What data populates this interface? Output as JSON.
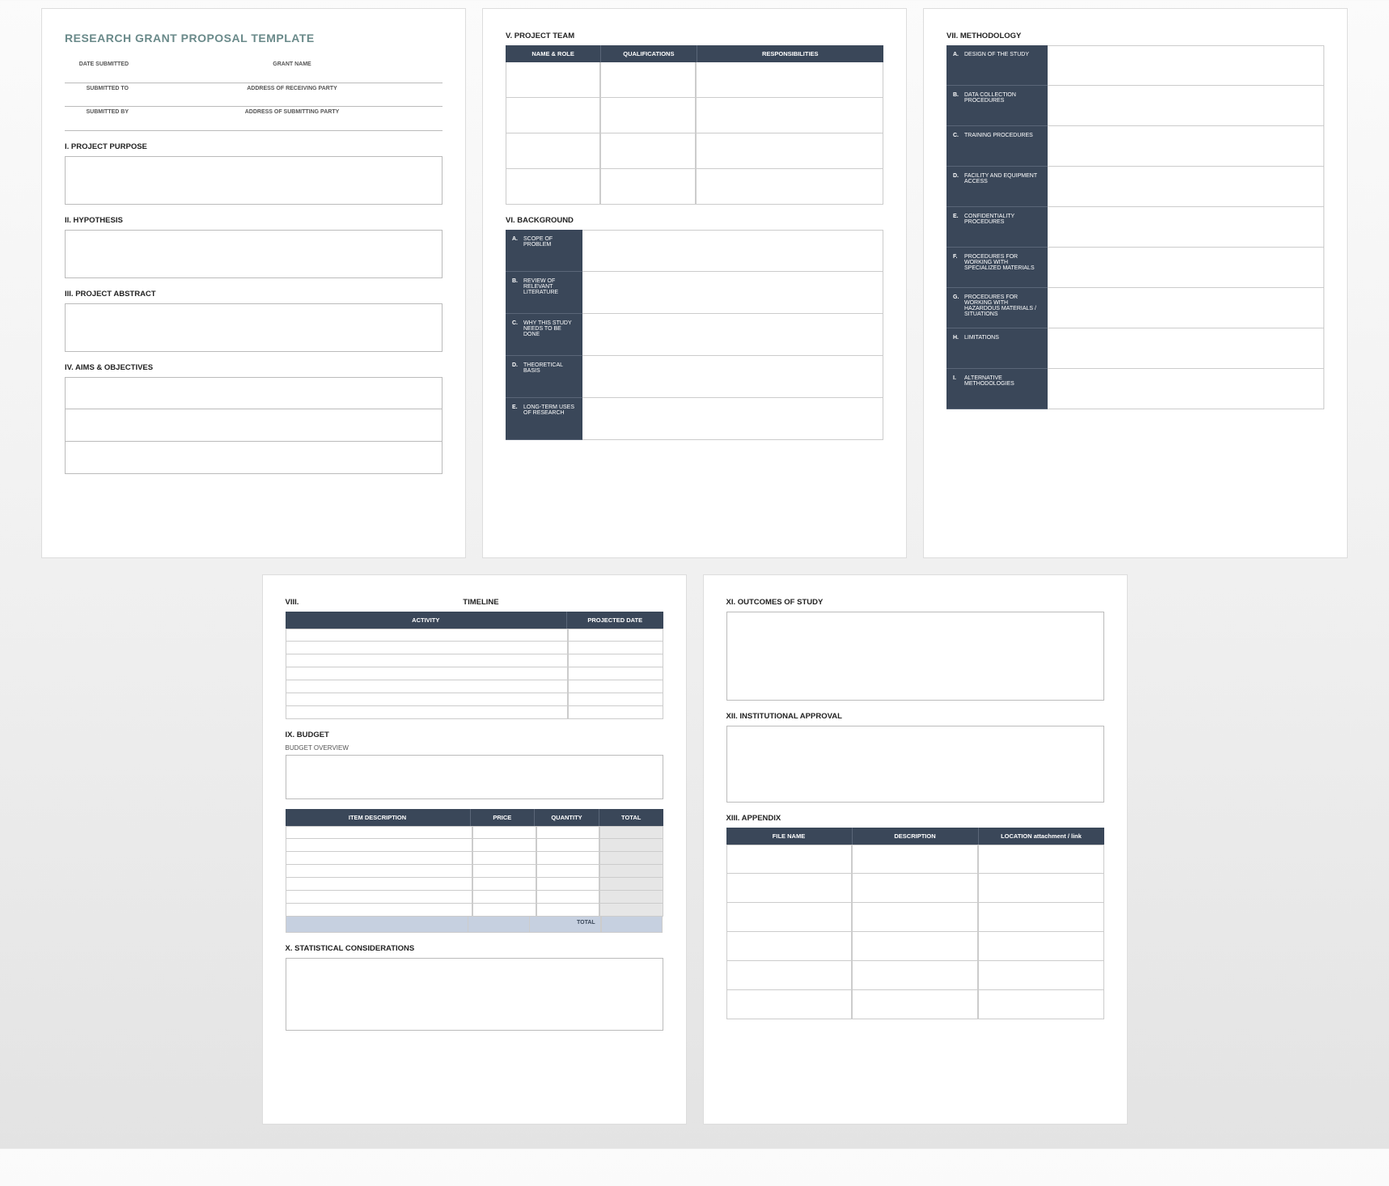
{
  "page1": {
    "title": "RESEARCH GRANT PROPOSAL TEMPLATE",
    "meta_hdr_date": "DATE SUBMITTED",
    "meta_hdr_name": "GRANT NAME",
    "meta_to": "SUBMITTED TO",
    "meta_to_addr": "ADDRESS OF RECEIVING PARTY",
    "meta_by": "SUBMITTED BY",
    "meta_by_addr": "ADDRESS OF SUBMITTING PARTY",
    "s1": "I.   PROJECT PURPOSE",
    "s2": "II.  HYPOTHESIS",
    "s3": "III.  PROJECT ABSTRACT",
    "s4": "IV. AIMS & OBJECTIVES"
  },
  "page2": {
    "s5": "V.  PROJECT TEAM",
    "th_name": "NAME & ROLE",
    "th_qual": "QUALIFICATIONS",
    "th_resp": "RESPONSIBILITIES",
    "s6": "VI. BACKGROUND",
    "bg": [
      {
        "l": "A.",
        "t": "SCOPE OF PROBLEM"
      },
      {
        "l": "B.",
        "t": "REVIEW OF RELEVANT LITERATURE"
      },
      {
        "l": "C.",
        "t": "WHY THIS STUDY NEEDS TO BE DONE"
      },
      {
        "l": "D.",
        "t": "THEORETICAL BASIS"
      },
      {
        "l": "E.",
        "t": "LONG-TERM USES OF RESEARCH"
      }
    ]
  },
  "page3": {
    "s7": "VII. METHODOLOGY",
    "m": [
      {
        "l": "A.",
        "t": "DESIGN OF THE STUDY"
      },
      {
        "l": "B.",
        "t": "DATA COLLECTION PROCEDURES"
      },
      {
        "l": "C.",
        "t": "TRAINING PROCEDURES"
      },
      {
        "l": "D.",
        "t": "FACILITY AND EQUIPMENT ACCESS"
      },
      {
        "l": "E.",
        "t": "CONFIDENTIALITY PROCEDURES"
      },
      {
        "l": "F.",
        "t": "PROCEDURES FOR WORKING WITH SPECIALIZED MATERIALS"
      },
      {
        "l": "G.",
        "t": "PROCEDURES FOR WORKING WITH HAZARDOUS MATERIALS / SITUATIONS"
      },
      {
        "l": "H.",
        "t": "LIMITATIONS"
      },
      {
        "l": "I.",
        "t": "ALTERNATIVE METHODOLOGIES"
      }
    ]
  },
  "page4": {
    "s8n": "VIII.",
    "s8t": "TIMELINE",
    "th_act": "ACTIVITY",
    "th_pd": "PROJECTED DATE",
    "s9": "IX. BUDGET",
    "s9s": "BUDGET OVERVIEW",
    "th_item": "ITEM DESCRIPTION",
    "th_price": "PRICE",
    "th_qty": "QUANTITY",
    "th_tot": "TOTAL",
    "tot_lbl": "TOTAL",
    "s10": "X.   STATISTICAL CONSIDERATIONS"
  },
  "page5": {
    "s11": "XI.  OUTCOMES OF STUDY",
    "s12": "XII. INSTITUTIONAL APPROVAL",
    "s13": "XIII. APPENDIX",
    "th_fn": "FILE NAME",
    "th_desc": "DESCRIPTION",
    "th_loc": "LOCATION attachment / link"
  }
}
